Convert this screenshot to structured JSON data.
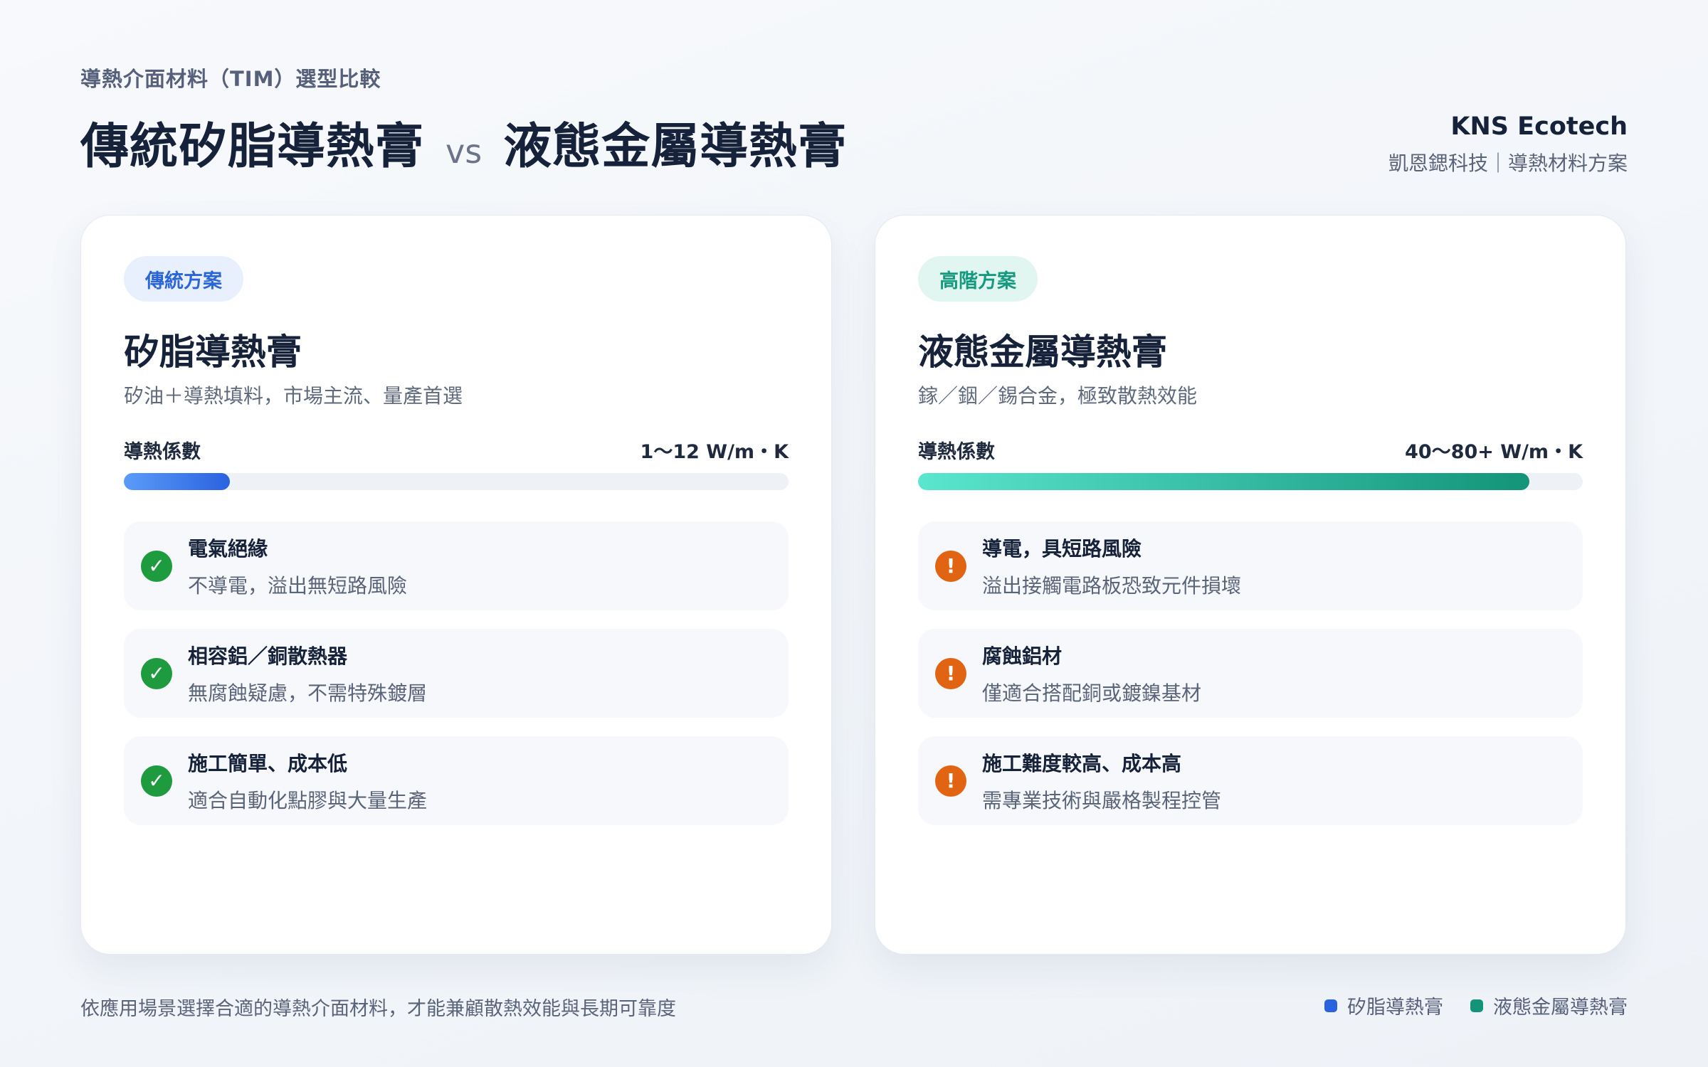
{
  "header": {
    "eyebrow": "導熱介面材料（TIM）選型比較",
    "title_left": "傳統矽脂導熱膏",
    "title_vs": "vs",
    "title_right": "液態金屬導熱膏"
  },
  "brand": {
    "name": "KNS Ecotech",
    "subtitle": "凱恩鍶科技｜導熱材料方案"
  },
  "cards": [
    {
      "badge": "傳統方案",
      "title": "矽脂導熱膏",
      "description": "矽油＋導熱填料，市場主流、量產首選",
      "metric_label": "導熱係數",
      "metric_value": "1～12 W/m・K",
      "bar_fraction": 0.16,
      "features": [
        {
          "icon": "check-icon",
          "title": "電氣絕緣",
          "subtitle": "不導電，溢出無短路風險"
        },
        {
          "icon": "check-icon",
          "title": "相容鋁／銅散熱器",
          "subtitle": "無腐蝕疑慮，不需特殊鍍層"
        },
        {
          "icon": "check-icon",
          "title": "施工簡單、成本低",
          "subtitle": "適合自動化點膠與大量生產"
        }
      ]
    },
    {
      "badge": "高階方案",
      "title": "液態金屬導熱膏",
      "description": "鎵／銦／錫合金，極致散熱效能",
      "metric_label": "導熱係數",
      "metric_value": "40～80+ W/m・K",
      "bar_fraction": 0.92,
      "features": [
        {
          "icon": "warning-icon",
          "title": "導電，具短路風險",
          "subtitle": "溢出接觸電路板恐致元件損壞"
        },
        {
          "icon": "warning-icon",
          "title": "腐蝕鋁材",
          "subtitle": "僅適合搭配銅或鍍鎳基材"
        },
        {
          "icon": "warning-icon",
          "title": "施工難度較高、成本高",
          "subtitle": "需專業技術與嚴格製程控管"
        }
      ]
    }
  ],
  "footer": {
    "note": "依應用場景選擇合適的導熱介面材料，才能兼顧散熱效能與長期可靠度",
    "legend": [
      {
        "label": "矽脂導熱膏",
        "color": "#2a62e0"
      },
      {
        "label": "液態金屬導熱膏",
        "color": "#139479"
      }
    ]
  },
  "colors": {
    "blue_accent": "#2a62e0",
    "teal_accent": "#139479",
    "check_green": "#1e9b3f",
    "warning_orange": "#e06411"
  }
}
